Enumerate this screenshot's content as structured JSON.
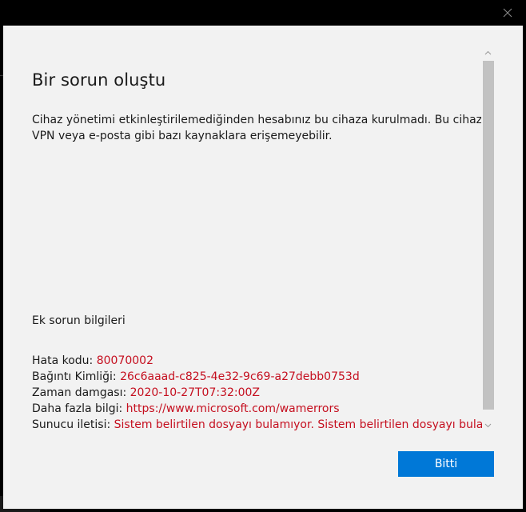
{
  "window": {
    "close_icon": "close-icon"
  },
  "dialog": {
    "title": "Bir sorun oluştu",
    "message_line1": "Cihaz yönetimi etkinleştirilemediğinden hesabınız bu cihaza kurulmadı. Bu cihaz, Wi-Fi",
    "message_line2": "VPN veya e-posta gibi bazı kaynaklara erişemeyebilir.",
    "extra_heading": "Ek sorun bilgileri",
    "details": [
      {
        "label": "Hata kodu: ",
        "value": "80070002"
      },
      {
        "label": "Bağıntı Kimliği: ",
        "value": "26c6aaad-c825-4e32-9c69-a27debb0753d"
      },
      {
        "label": "Zaman damgası: ",
        "value": "2020-10-27T07:32:00Z"
      },
      {
        "label": "Daha fazla bilgi: ",
        "value": "https://www.microsoft.com/wamerrors"
      },
      {
        "label": "Sunucu iletisi: ",
        "value": "Sistem belirtilen dosyayı bulamıyor. Sistem belirtilen dosyayı bulamıyor."
      }
    ],
    "primary_button": "Bitti"
  },
  "colors": {
    "accent": "#0078d7",
    "error_value": "#c50f1f",
    "dialog_background": "#f2f2f2",
    "window_frame": "#000000"
  }
}
